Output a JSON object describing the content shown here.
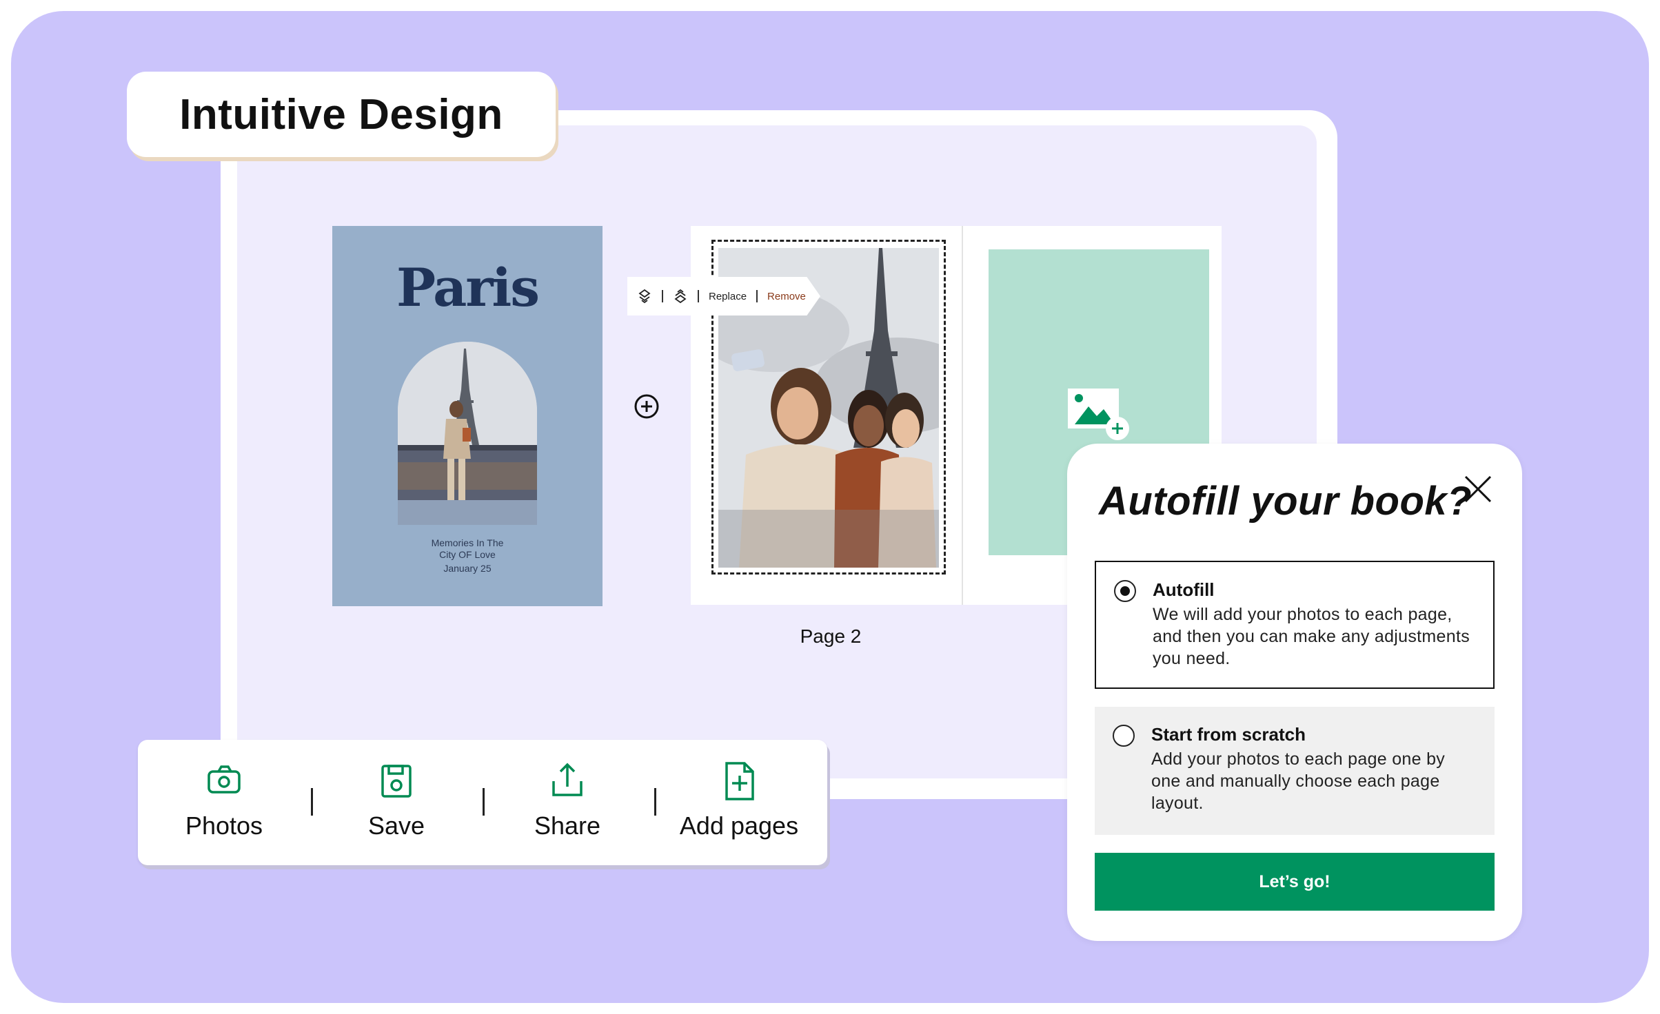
{
  "header": {
    "title": "Intuitive Design"
  },
  "cover": {
    "title": "Paris",
    "subtitle_line1": "Memories In The",
    "subtitle_line2": "City OF Love",
    "date": "January 25"
  },
  "photo_toolbar": {
    "replace_label": "Replace",
    "remove_label": "Remove",
    "icons": [
      "bring-forward-icon",
      "send-backward-icon"
    ]
  },
  "spread": {
    "page_label": "Page 2"
  },
  "bottom_toolbar": {
    "items": [
      {
        "label": "Photos",
        "icon": "camera-icon"
      },
      {
        "label": "Save",
        "icon": "floppy-disk-icon"
      },
      {
        "label": "Share",
        "icon": "share-upload-icon"
      },
      {
        "label": "Add pages",
        "icon": "add-page-icon"
      }
    ]
  },
  "dialog": {
    "title": "Autofill your book?",
    "options": [
      {
        "title": "Autofill",
        "desc_line1": "We will add your photos to each page,",
        "desc_line2": "and then you can make any adjustments",
        "desc_line3": "you need.",
        "selected": true
      },
      {
        "title": "Start from scratch",
        "desc_line1": "Add your photos to each page one by",
        "desc_line2": "one and manually choose each page",
        "desc_line3": "layout.",
        "selected": false
      }
    ],
    "cta_label": "Let’s go!"
  },
  "colors": {
    "background": "#cbc4fb",
    "canvas": "#efecfd",
    "cover": "#97afca",
    "cover_title": "#1f3358",
    "mint_slot": "#b3e0d1",
    "accent_green": "#00935f",
    "remove_text": "#8a3a1a"
  }
}
